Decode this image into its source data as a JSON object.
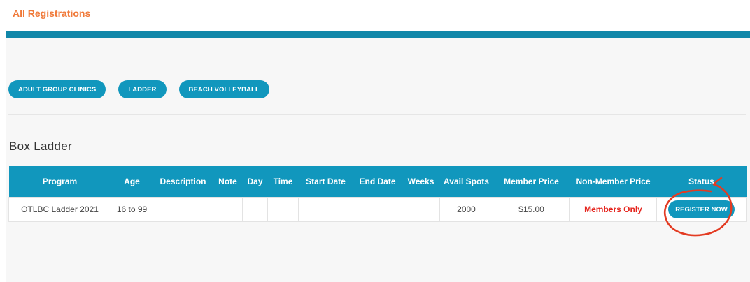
{
  "header": {
    "breadcrumb": "All Registrations"
  },
  "colors": {
    "accent": "#1197bd",
    "accent_bar": "#1187a9",
    "breadcrumb": "#f07a3a",
    "warning": "#e5241d",
    "annotation": "#e33b22"
  },
  "filters": [
    {
      "label": "ADULT GROUP CLINICS"
    },
    {
      "label": "LADDER"
    },
    {
      "label": "BEACH VOLLEYBALL"
    }
  ],
  "section": {
    "title": "Box Ladder"
  },
  "table": {
    "columns": [
      "Program",
      "Age",
      "Description",
      "Note",
      "Day",
      "Time",
      "Start Date",
      "End Date",
      "Weeks",
      "Avail Spots",
      "Member Price",
      "Non-Member Price",
      "Status"
    ],
    "rows": [
      {
        "program": "OTLBC Ladder 2021",
        "age": "16 to 99",
        "description": "",
        "note": "",
        "day": "",
        "time": "",
        "start_date": "",
        "end_date": "",
        "weeks": "",
        "avail_spots": "2000",
        "member_price": "$15.00",
        "non_member_price": "Members Only",
        "status_button": "REGISTER NOW"
      }
    ]
  }
}
